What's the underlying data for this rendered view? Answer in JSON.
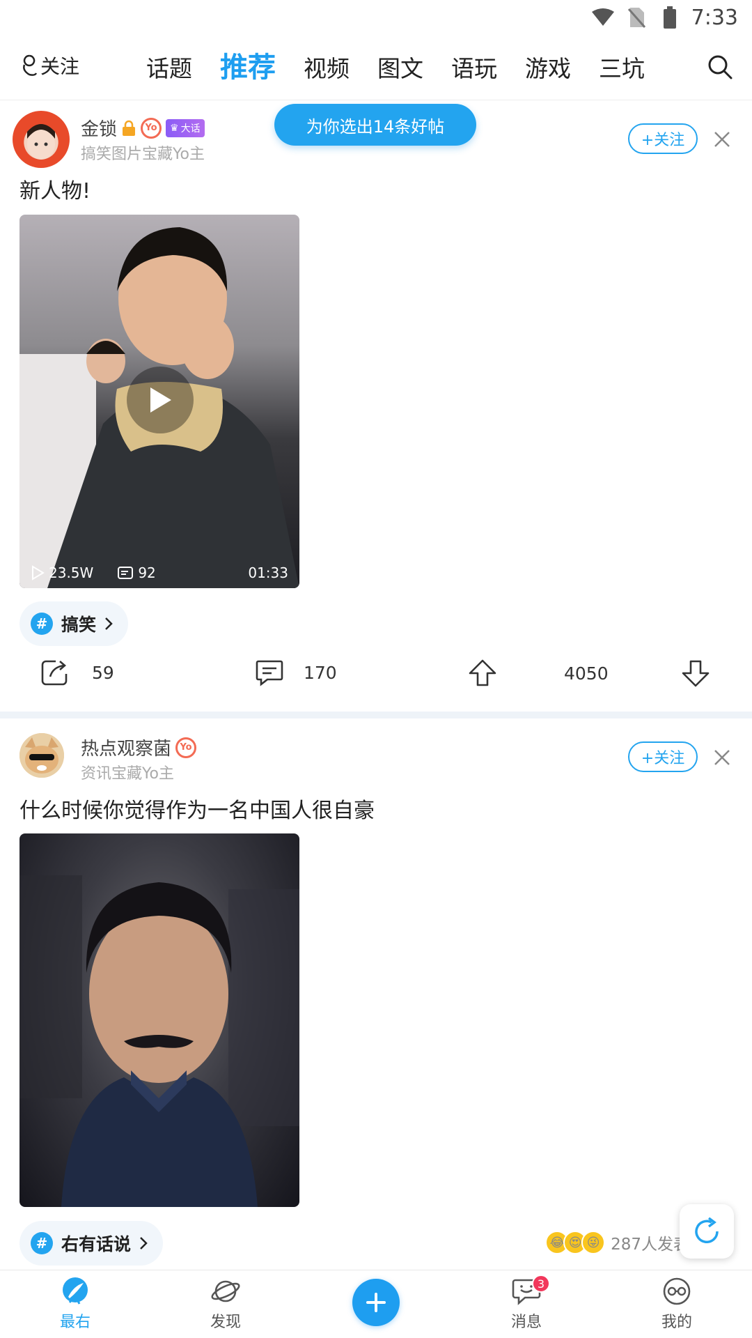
{
  "status_bar": {
    "time": "7:33"
  },
  "top_nav": {
    "follow_label": "关注",
    "tabs": [
      {
        "label": "话题",
        "active": false
      },
      {
        "label": "推荐",
        "active": true
      },
      {
        "label": "视频",
        "active": false
      },
      {
        "label": "图文",
        "active": false
      },
      {
        "label": "语玩",
        "active": false
      },
      {
        "label": "游戏",
        "active": false
      },
      {
        "label": "三坑",
        "active": false
      }
    ]
  },
  "toast": {
    "text": "为你选出14条好帖"
  },
  "posts": [
    {
      "author": "金锁",
      "badge_yo": "Yo",
      "badge_vip": "大话",
      "subtitle": "搞笑图片宝藏Yo主",
      "follow_label": "+关注",
      "text": "新人物!",
      "media": {
        "type": "video",
        "plays": "23.5W",
        "comments": "92",
        "duration": "01:33"
      },
      "topic": "搞笑",
      "actions": {
        "share": "59",
        "comment": "170",
        "like": "4050"
      }
    },
    {
      "author": "热点观察菌",
      "badge_yo": "Yo",
      "subtitle": "资讯宝藏Yo主",
      "follow_label": "+关注",
      "text": "什么时候你觉得作为一名中国人很自豪",
      "media": {
        "type": "image"
      },
      "topic": "右有话说",
      "reactions_text": "287人发表"
    }
  ],
  "bottom_nav": {
    "items": [
      {
        "label": "最右",
        "active": true
      },
      {
        "label": "发现",
        "active": false
      },
      {
        "label": "消息",
        "active": false,
        "badge": "3"
      },
      {
        "label": "我的",
        "active": false
      }
    ]
  },
  "colors": {
    "accent": "#1e9ef0",
    "badge_red": "#f2375b",
    "divider": "#eef3f8"
  }
}
